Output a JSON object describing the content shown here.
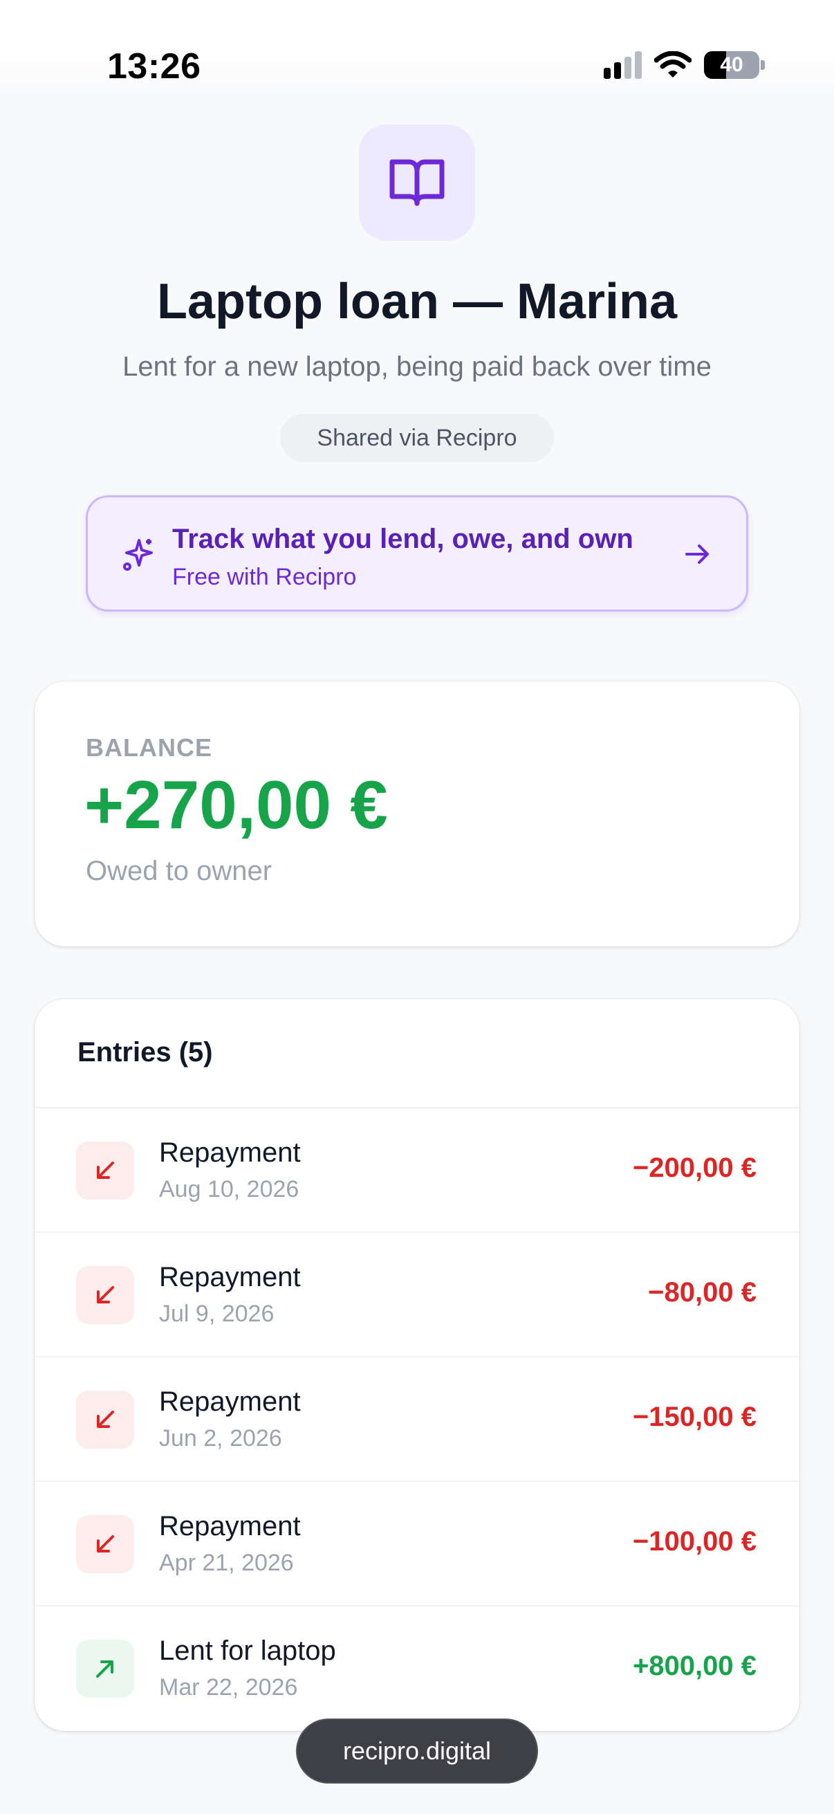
{
  "status_bar": {
    "time": "13:26",
    "battery_percent": "40"
  },
  "header": {
    "icon": "open-book-icon",
    "title": "Laptop loan — Marina",
    "subtitle": "Lent for a new laptop, being paid back over time",
    "shared_label": "Shared via Recipro"
  },
  "promo": {
    "icon": "sparkle-icon",
    "headline": "Track what you lend, owe, and own",
    "subline": "Free with Recipro",
    "arrow_icon": "arrow-right-icon"
  },
  "balance": {
    "label": "BALANCE",
    "value": "+270,00 €",
    "note": "Owed to owner"
  },
  "entries": {
    "heading": "Entries (5)",
    "items": [
      {
        "title": "Repayment",
        "date": "Aug 10, 2026",
        "amount": "−200,00 €",
        "direction": "out"
      },
      {
        "title": "Repayment",
        "date": "Jul 9, 2026",
        "amount": "−80,00 €",
        "direction": "out"
      },
      {
        "title": "Repayment",
        "date": "Jun 2, 2026",
        "amount": "−150,00 €",
        "direction": "out"
      },
      {
        "title": "Repayment",
        "date": "Apr 21, 2026",
        "amount": "−100,00 €",
        "direction": "out"
      },
      {
        "title": "Lent for laptop",
        "date": "Mar 22, 2026",
        "amount": "+800,00 €",
        "direction": "in"
      }
    ]
  },
  "footer": {
    "domain": "recipro.digital"
  },
  "colors": {
    "accent": "#7c3aed",
    "positive": "#16a34a",
    "negative": "#dc2626"
  }
}
